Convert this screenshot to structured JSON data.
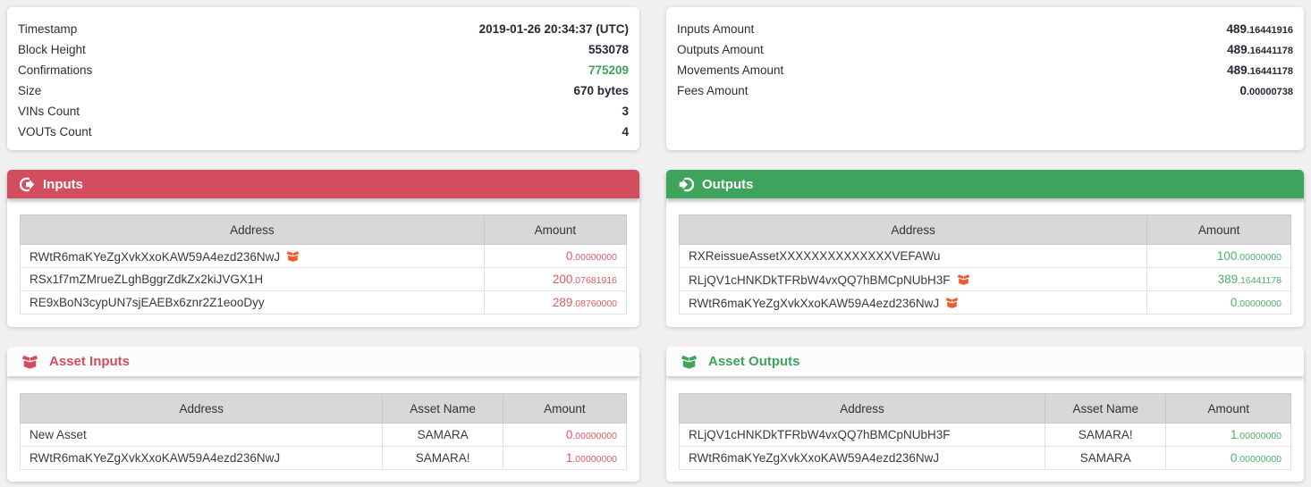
{
  "colors": {
    "red": "#d24d5e",
    "green": "#3ea35b",
    "amount_red": "#e25964",
    "amount_green": "#4caf6e",
    "orange": "#ee5c2d"
  },
  "icons": {
    "inputs_header": "sign-out-icon",
    "outputs_header": "sign-in-icon",
    "asset_marker": "box-open-icon"
  },
  "summary_left": [
    {
      "label": "Timestamp",
      "value": "2019-01-26 20:34:37 (UTC)",
      "style": ""
    },
    {
      "label": "Block Height",
      "value": "553078",
      "style": ""
    },
    {
      "label": "Confirmations",
      "value": "775209",
      "style": "green"
    },
    {
      "label": "Size",
      "value": "670 bytes",
      "style": ""
    },
    {
      "label": "VINs Count",
      "value": "3",
      "style": ""
    },
    {
      "label": "VOUTs Count",
      "value": "4",
      "style": ""
    }
  ],
  "summary_right": [
    {
      "label": "Inputs Amount",
      "int": "489",
      "dec": ".16441916"
    },
    {
      "label": "Outputs Amount",
      "int": "489",
      "dec": ".16441178"
    },
    {
      "label": "Movements Amount",
      "int": "489",
      "dec": ".16441178"
    },
    {
      "label": "Fees Amount",
      "int": "0",
      "dec": ".00000738"
    }
  ],
  "inputs": {
    "title": "Inputs",
    "columns": [
      "Address",
      "Amount"
    ],
    "rows": [
      {
        "address": "RWtR6maKYeZgXvkXxoKAW59A4ezd236NwJ",
        "has_asset_icon": true,
        "int": "0",
        "dec": ".00000000"
      },
      {
        "address": "RSx1f7mZMrueZLghBggrZdkZx2kiJVGX1H",
        "has_asset_icon": false,
        "int": "200",
        "dec": ".07681916"
      },
      {
        "address": "RE9xBoN3cypUN7sjEAEBx6znr2Z1eooDyy",
        "has_asset_icon": false,
        "int": "289",
        "dec": ".08760000"
      }
    ]
  },
  "outputs": {
    "title": "Outputs",
    "columns": [
      "Address",
      "Amount"
    ],
    "rows": [
      {
        "address": "RXReissueAssetXXXXXXXXXXXXXXVEFAWu",
        "has_asset_icon": false,
        "int": "100",
        "dec": ".00000000"
      },
      {
        "address": "RLjQV1cHNKDkTFRbW4vxQQ7hBMCpNUbH3F",
        "has_asset_icon": true,
        "int": "389",
        "dec": ".16441178"
      },
      {
        "address": "RWtR6maKYeZgXvkXxoKAW59A4ezd236NwJ",
        "has_asset_icon": true,
        "int": "0",
        "dec": ".00000000"
      }
    ]
  },
  "asset_inputs": {
    "title": "Asset Inputs",
    "columns": [
      "Address",
      "Asset Name",
      "Amount"
    ],
    "rows": [
      {
        "address": "New Asset",
        "asset_name": "SAMARA",
        "int": "0",
        "dec": ".00000000"
      },
      {
        "address": "RWtR6maKYeZgXvkXxoKAW59A4ezd236NwJ",
        "asset_name": "SAMARA!",
        "int": "1",
        "dec": ".00000000"
      }
    ]
  },
  "asset_outputs": {
    "title": "Asset Outputs",
    "columns": [
      "Address",
      "Asset Name",
      "Amount"
    ],
    "rows": [
      {
        "address": "RLjQV1cHNKDkTFRbW4vxQQ7hBMCpNUbH3F",
        "asset_name": "SAMARA!",
        "int": "1",
        "dec": ".00000000"
      },
      {
        "address": "RWtR6maKYeZgXvkXxoKAW59A4ezd236NwJ",
        "asset_name": "SAMARA",
        "int": "0",
        "dec": ".00000000"
      }
    ]
  }
}
